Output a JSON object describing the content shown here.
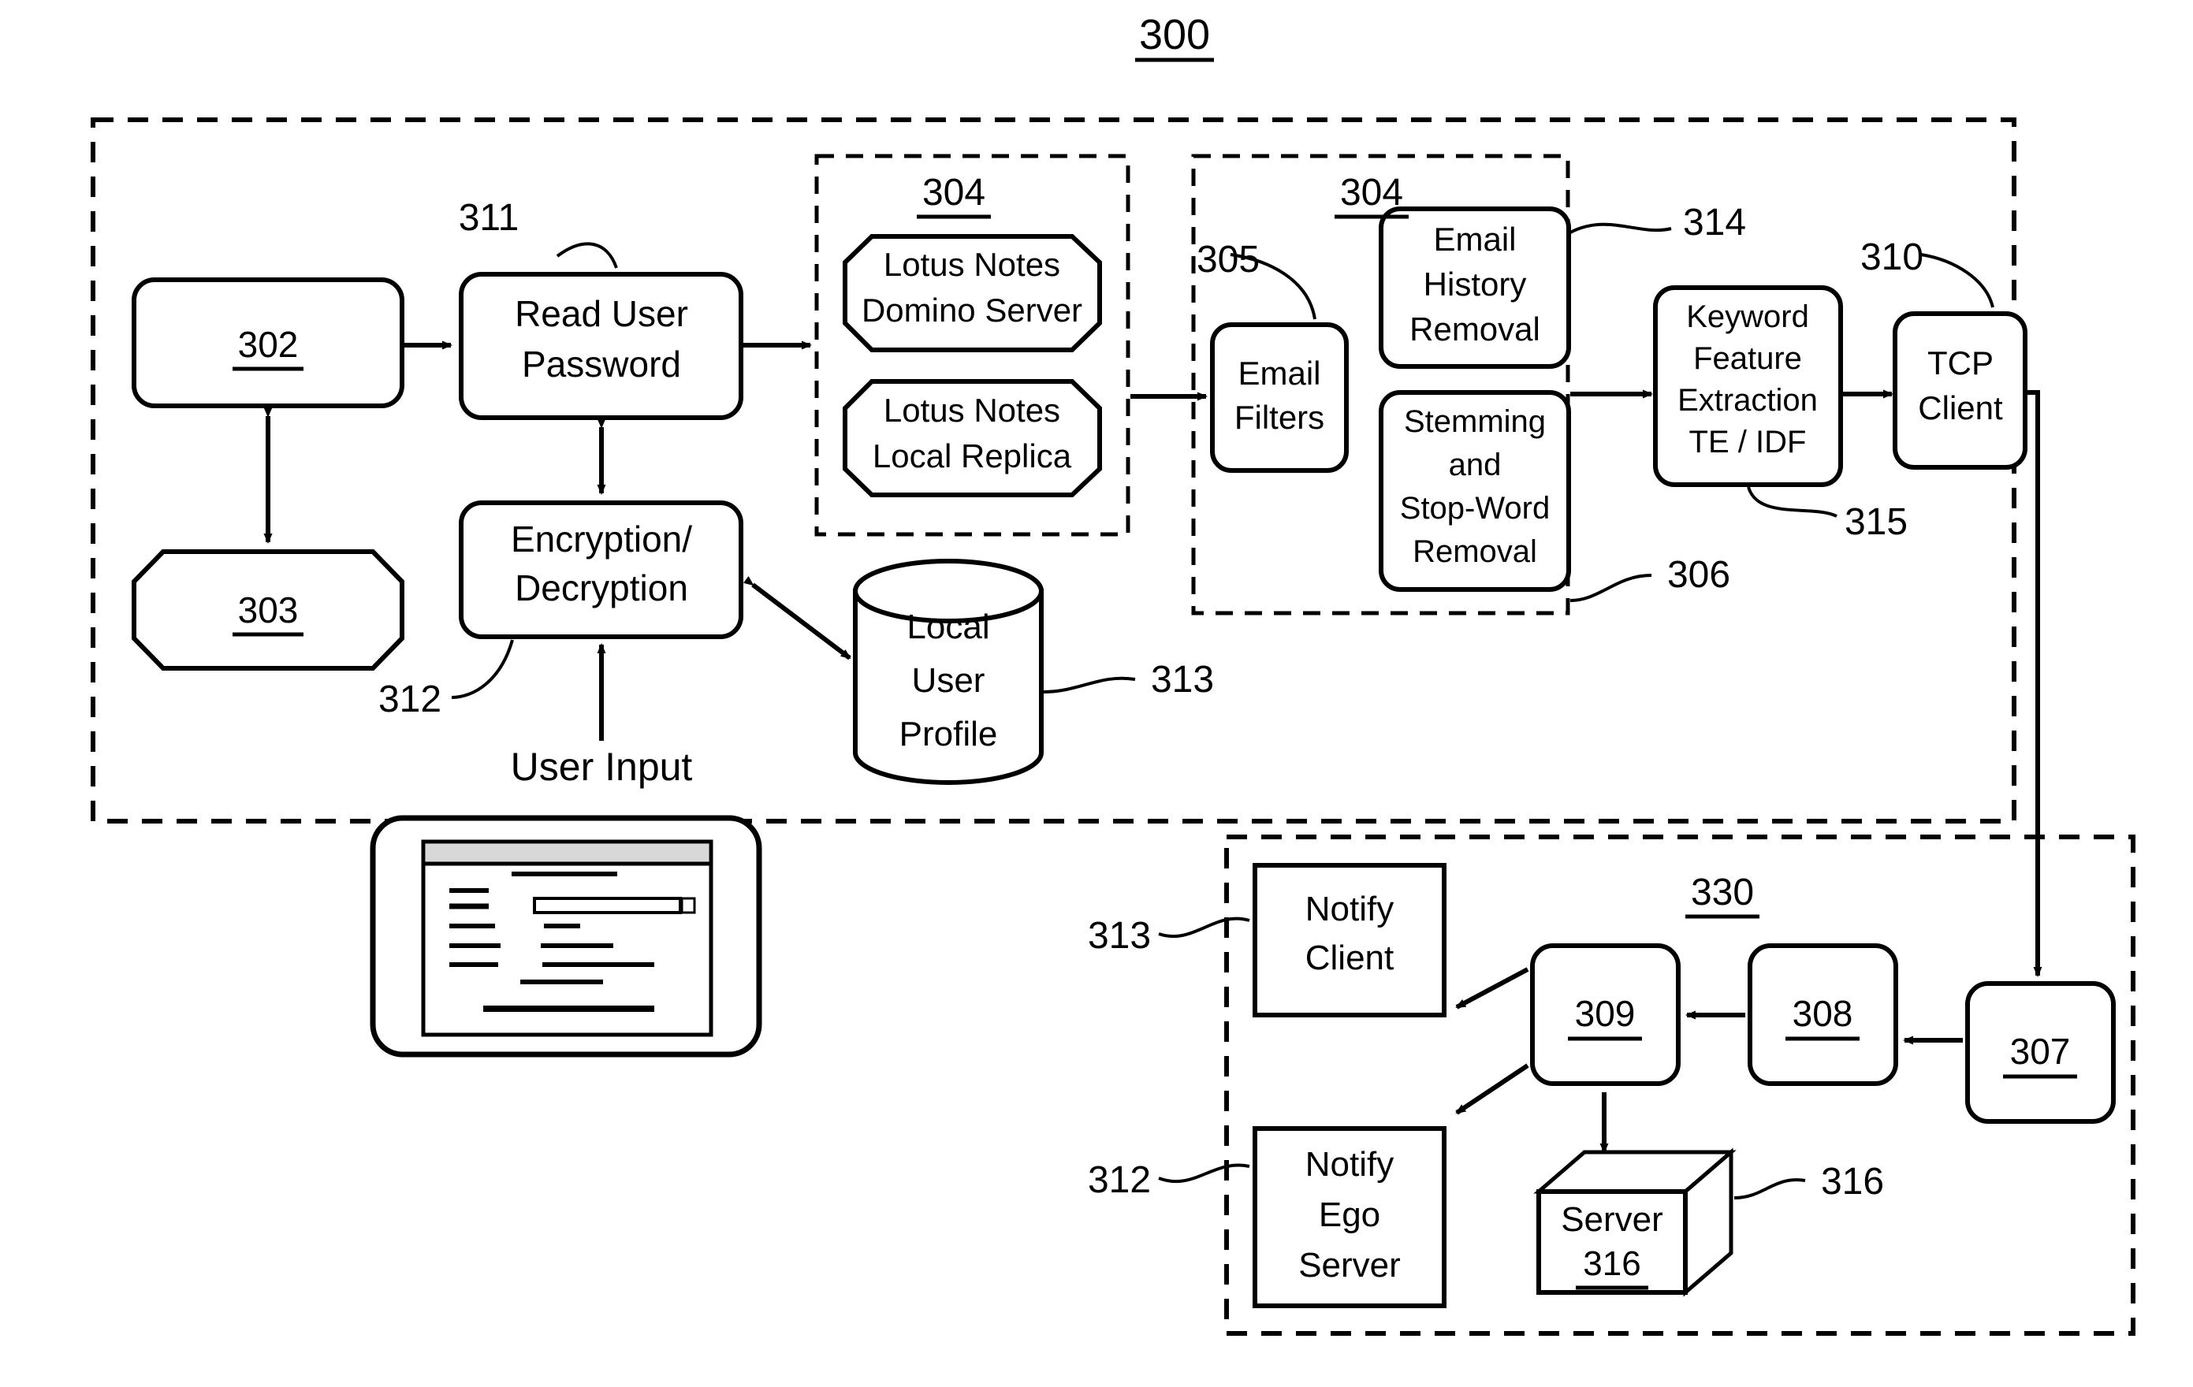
{
  "figure": {
    "number": "300",
    "title_label": "300"
  },
  "groups": {
    "client_boundary": {
      "label": ""
    },
    "notes_group": {
      "label": "304"
    },
    "email_group": {
      "label": "304"
    },
    "server_boundary": {
      "label": "330"
    }
  },
  "nodes": {
    "n302": {
      "label": "302",
      "shape": "rounded-rect"
    },
    "n303": {
      "label": "303",
      "shape": "octagon"
    },
    "read_user_password": {
      "label_line1": "Read User",
      "label_line2": "Password",
      "shape": "rounded-rect"
    },
    "encryption_decryption": {
      "label_line1": "Encryption/",
      "label_line2": "Decryption",
      "shape": "rounded-rect"
    },
    "user_input": {
      "label": "User Input"
    },
    "lotus_domino": {
      "label_line1": "Lotus Notes",
      "label_line2": "Domino Server",
      "shape": "octagon"
    },
    "lotus_replica": {
      "label_line1": "Lotus Notes",
      "label_line2": "Local Replica",
      "shape": "octagon"
    },
    "local_user_profile": {
      "label_line1": "Local",
      "label_line2": "User",
      "label_line3": "Profile",
      "shape": "cylinder"
    },
    "email_filters": {
      "label_line1": "Email",
      "label_line2": "Filters",
      "shape": "rounded-rect"
    },
    "email_history_removal": {
      "label_line1": "Email",
      "label_line2": "History",
      "label_line3": "Removal",
      "shape": "rounded-rect"
    },
    "stemming_stopword": {
      "label_line1": "Stemming",
      "label_line2": "and",
      "label_line3": "Stop-Word",
      "label_line4": "Removal",
      "shape": "rounded-rect"
    },
    "keyword_feature_extraction": {
      "label_line1": "Keyword",
      "label_line2": "Feature",
      "label_line3": "Extraction",
      "label_line4": "TE / IDF",
      "shape": "rounded-rect"
    },
    "tcp_client": {
      "label_line1": "TCP",
      "label_line2": "Client",
      "shape": "rounded-rect"
    },
    "notify_client": {
      "label_line1": "Notify",
      "label_line2": "Client",
      "shape": "rect"
    },
    "notify_ego_server": {
      "label_line1": "Notify",
      "label_line2": "Ego",
      "label_line3": "Server",
      "shape": "rect"
    },
    "n309": {
      "label": "309",
      "shape": "rounded-rect"
    },
    "n308": {
      "label": "308",
      "shape": "rounded-rect"
    },
    "n307": {
      "label": "307",
      "shape": "rounded-rect"
    },
    "server_316": {
      "label_line1": "Server",
      "label_line2": "316",
      "shape": "cube"
    }
  },
  "reference_numerals": {
    "r311": "311",
    "r312_client": "312",
    "r313_profile": "313",
    "r305": "305",
    "r306": "306",
    "r314": "314",
    "r315": "315",
    "r310": "310",
    "r313_notify": "313",
    "r312_notify": "312",
    "r316": "316"
  },
  "device_illustration": {
    "name": "tablet-device",
    "screen_titlebar": "",
    "content_lines": 9
  },
  "colors": {
    "stroke": "#000000",
    "background": "#ffffff",
    "titlebar_fill": "#d8d8d8"
  }
}
